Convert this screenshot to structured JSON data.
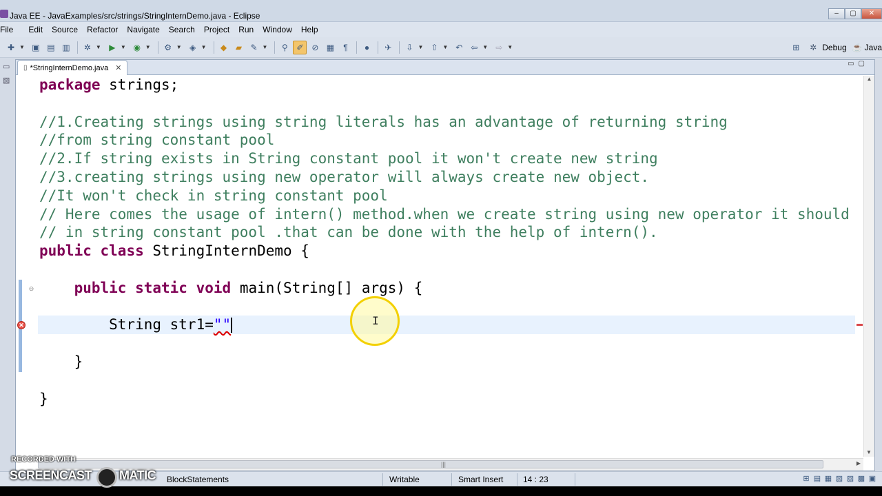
{
  "window": {
    "title": "Java EE - JavaExamples/src/strings/StringInternDemo.java - Eclipse",
    "controls": [
      "–",
      "▢",
      "✕"
    ]
  },
  "menu": [
    "File",
    "Edit",
    "Source",
    "Refactor",
    "Navigate",
    "Search",
    "Project",
    "Run",
    "Window",
    "Help"
  ],
  "perspectives": [
    {
      "label": "Debug",
      "icon": "debug-perspective-icon"
    },
    {
      "label": "Java",
      "icon": "java-perspective-icon"
    }
  ],
  "editor": {
    "tab_label": "*StringInternDemo.java",
    "lines": [
      [
        {
          "t": "package",
          "k": "kw"
        },
        {
          "t": " strings;",
          "k": ""
        }
      ],
      [
        {
          "t": "",
          "k": ""
        }
      ],
      [
        {
          "t": "//1.Creating strings using string literals has an advantage of returning string",
          "k": "cm"
        }
      ],
      [
        {
          "t": "//from string constant pool",
          "k": "cm"
        }
      ],
      [
        {
          "t": "//2.If string exists in String constant pool it won't create new string",
          "k": "cm"
        }
      ],
      [
        {
          "t": "//3.creating strings using new operator will always create new object.",
          "k": "cm"
        }
      ],
      [
        {
          "t": "//It won't check in string constant pool",
          "k": "cm"
        }
      ],
      [
        {
          "t": "// Here comes the usage of intern() method.when we create string using new operator it should c",
          "k": "cm"
        }
      ],
      [
        {
          "t": "// in string constant pool .that can be done with the help of intern().",
          "k": "cm"
        }
      ],
      [
        {
          "t": "public",
          "k": "kw"
        },
        {
          "t": " ",
          "k": ""
        },
        {
          "t": "class",
          "k": "kw"
        },
        {
          "t": " StringInternDemo {",
          "k": ""
        }
      ],
      [
        {
          "t": "",
          "k": ""
        }
      ],
      [
        {
          "t": "    ",
          "k": ""
        },
        {
          "t": "public",
          "k": "kw"
        },
        {
          "t": " ",
          "k": ""
        },
        {
          "t": "static",
          "k": "kw"
        },
        {
          "t": " ",
          "k": ""
        },
        {
          "t": "void",
          "k": "kw"
        },
        {
          "t": " main(String[] args) {",
          "k": ""
        }
      ],
      [
        {
          "t": "",
          "k": ""
        }
      ],
      [
        {
          "t": "        String str1=",
          "k": ""
        },
        {
          "t": "\"\"",
          "k": "str"
        }
      ],
      [
        {
          "t": "",
          "k": ""
        }
      ],
      [
        {
          "t": "    }",
          "k": ""
        }
      ],
      [
        {
          "t": "",
          "k": ""
        }
      ],
      [
        {
          "t": "}",
          "k": ""
        }
      ]
    ],
    "current_line": 13
  },
  "status": {
    "message": "BlockStatements",
    "writable": "Writable",
    "insert_mode": "Smart Insert",
    "position": "14 : 23"
  },
  "watermark": {
    "line1": "RECORDED WITH",
    "line2": "SCREENCAST",
    "line3": "MATIC"
  }
}
